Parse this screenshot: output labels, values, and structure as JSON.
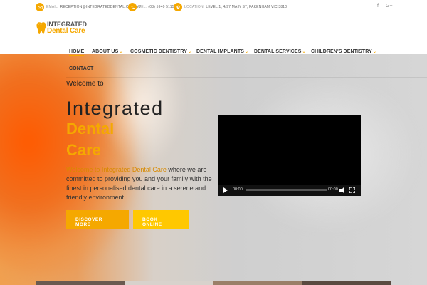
{
  "topbar": {
    "email_key": "EMAIL:",
    "email_value": "RECEPTION@INTEGRATEDDENTAL.COM.AU",
    "tel_key": "TEL:",
    "tel_value": "(03) 5940 5115",
    "location_key": "LOCATION:",
    "location_value": "LEVEL 1, 4/97 MAIN ST, PAKENHAM VIC 3810",
    "social": [
      "f",
      "G+"
    ]
  },
  "logo": {
    "line1": "INTEGRATED",
    "line2": "Dental Care"
  },
  "nav": {
    "items": [
      {
        "label": "HOME",
        "chevron": ""
      },
      {
        "label": "ABOUT US",
        "chevron": "⌄"
      },
      {
        "label": "COSMETIC DENTISTRY",
        "chevron": "⌄"
      },
      {
        "label": "DENTAL IMPLANTS",
        "chevron": "⌄"
      },
      {
        "label": "DENTAL SERVICES",
        "chevron": "⌄"
      },
      {
        "label": "CHILDREN'S DENTISTRY",
        "chevron": "⌄"
      },
      {
        "label": "CONTACT",
        "chevron": ""
      }
    ]
  },
  "hero": {
    "welcome": "Welcome to",
    "title_line1": "Integrated",
    "title_line2": "Dental",
    "title_line3": "Care",
    "intro_prefix": "Welcome to Integrated Dental Care",
    "intro_rest": " where we are committed to providing you and your family with the finest in personalised dental care in a serene and friendly environment.",
    "btn_discover_line1": "DISCOVER",
    "btn_discover_line2": "MORE",
    "btn_book_line1": "BOOK",
    "btn_book_line2": "ONLINE"
  },
  "video": {
    "current_time": "00:00",
    "duration": "00:00"
  },
  "colors": {
    "accent": "#f5a800",
    "accent_light": "#ffc800"
  }
}
